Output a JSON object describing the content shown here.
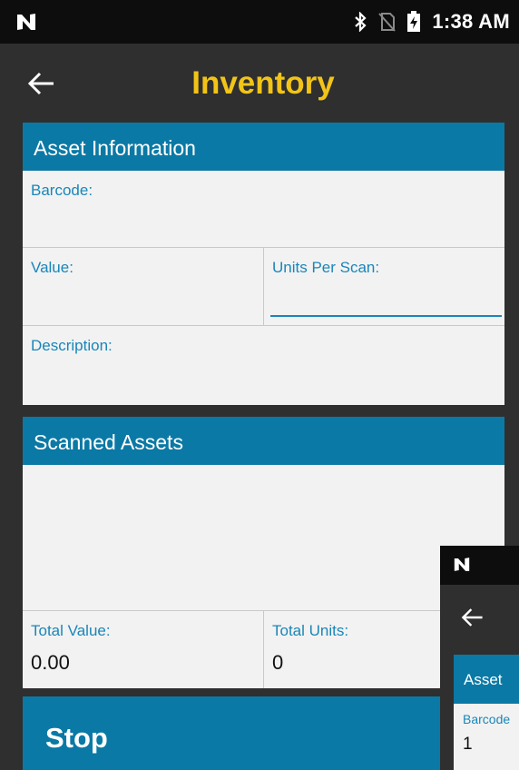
{
  "status_bar": {
    "time": "1:38 AM",
    "icons": [
      "notification-n-icon",
      "bluetooth-icon",
      "no-sim-icon",
      "battery-charging-icon"
    ]
  },
  "app_bar": {
    "title": "Inventory",
    "back_icon": "arrow-left-icon"
  },
  "asset_information": {
    "header": "Asset Information",
    "barcode_label": "Barcode:",
    "barcode_value": "",
    "value_label": "Value:",
    "value_value": "",
    "units_per_scan_label": "Units Per Scan:",
    "units_per_scan_value": "",
    "description_label": "Description:",
    "description_value": ""
  },
  "scanned_assets": {
    "header": "Scanned Assets",
    "items": [],
    "total_value_label": "Total Value:",
    "total_value": "0.00",
    "total_units_label": "Total Units:",
    "total_units": "0"
  },
  "stop_button": {
    "label": "Stop"
  },
  "overlay_preview": {
    "card_header": "Asset",
    "barcode_label": "Barcode",
    "barcode_value": "1"
  },
  "colors": {
    "accent": "#0b79a5",
    "title": "#f2c418",
    "label": "#1a86b8",
    "background": "#2f2f2f",
    "card": "#f2f2f2",
    "status_bar": "#0d0d0d"
  }
}
